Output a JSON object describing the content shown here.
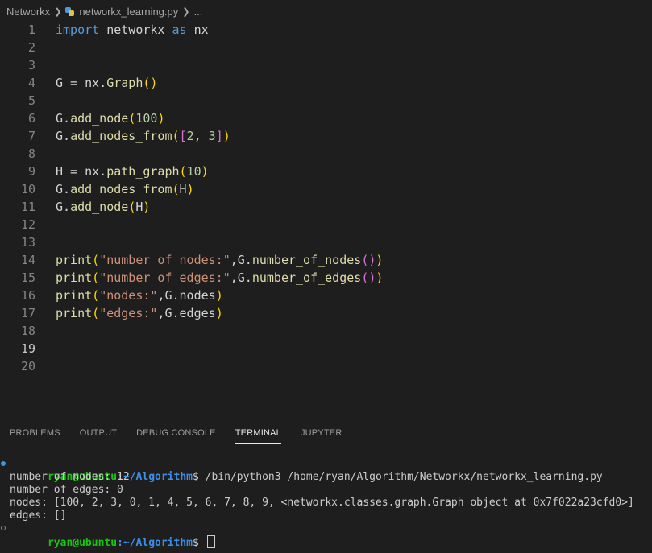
{
  "breadcrumb": {
    "folder": "Networkx",
    "file": "networkx_learning.py",
    "more": "..."
  },
  "editor": {
    "current_line": 19,
    "lines": [
      {
        "n": "1",
        "tokens": [
          {
            "t": "import",
            "c": "kw"
          },
          {
            "t": " networkx "
          },
          {
            "t": "as",
            "c": "kw"
          },
          {
            "t": " nx"
          }
        ]
      },
      {
        "n": "2",
        "tokens": []
      },
      {
        "n": "3",
        "tokens": []
      },
      {
        "n": "4",
        "tokens": [
          {
            "t": "G = nx."
          },
          {
            "t": "Graph",
            "c": "fn"
          },
          {
            "t": "()",
            "c": "br1"
          }
        ]
      },
      {
        "n": "5",
        "tokens": []
      },
      {
        "n": "6",
        "tokens": [
          {
            "t": "G."
          },
          {
            "t": "add_node",
            "c": "fn"
          },
          {
            "t": "(",
            "c": "br1"
          },
          {
            "t": "100",
            "c": "num"
          },
          {
            "t": ")",
            "c": "br1"
          }
        ]
      },
      {
        "n": "7",
        "tokens": [
          {
            "t": "G."
          },
          {
            "t": "add_nodes_from",
            "c": "fn"
          },
          {
            "t": "(",
            "c": "br1"
          },
          {
            "t": "[",
            "c": "br2"
          },
          {
            "t": "2",
            "c": "num"
          },
          {
            "t": ", "
          },
          {
            "t": "3",
            "c": "num"
          },
          {
            "t": "]",
            "c": "br2"
          },
          {
            "t": ")",
            "c": "br1"
          }
        ]
      },
      {
        "n": "8",
        "tokens": []
      },
      {
        "n": "9",
        "tokens": [
          {
            "t": "H = nx."
          },
          {
            "t": "path_graph",
            "c": "fn"
          },
          {
            "t": "(",
            "c": "br1"
          },
          {
            "t": "10",
            "c": "num"
          },
          {
            "t": ")",
            "c": "br1"
          }
        ]
      },
      {
        "n": "10",
        "tokens": [
          {
            "t": "G."
          },
          {
            "t": "add_nodes_from",
            "c": "fn"
          },
          {
            "t": "(",
            "c": "br1"
          },
          {
            "t": "H"
          },
          {
            "t": ")",
            "c": "br1"
          }
        ]
      },
      {
        "n": "11",
        "tokens": [
          {
            "t": "G."
          },
          {
            "t": "add_node",
            "c": "fn"
          },
          {
            "t": "(",
            "c": "br1"
          },
          {
            "t": "H"
          },
          {
            "t": ")",
            "c": "br1"
          }
        ]
      },
      {
        "n": "12",
        "tokens": []
      },
      {
        "n": "13",
        "tokens": []
      },
      {
        "n": "14",
        "tokens": [
          {
            "t": "print",
            "c": "fn"
          },
          {
            "t": "(",
            "c": "br1"
          },
          {
            "t": "\"number of nodes:\"",
            "c": "str"
          },
          {
            "t": ",G."
          },
          {
            "t": "number_of_nodes",
            "c": "fn"
          },
          {
            "t": "()",
            "c": "br2"
          },
          {
            "t": ")",
            "c": "br1"
          }
        ]
      },
      {
        "n": "15",
        "tokens": [
          {
            "t": "print",
            "c": "fn"
          },
          {
            "t": "(",
            "c": "br1"
          },
          {
            "t": "\"number of edges:\"",
            "c": "str"
          },
          {
            "t": ",G."
          },
          {
            "t": "number_of_edges",
            "c": "fn"
          },
          {
            "t": "()",
            "c": "br2"
          },
          {
            "t": ")",
            "c": "br1"
          }
        ]
      },
      {
        "n": "16",
        "tokens": [
          {
            "t": "print",
            "c": "fn"
          },
          {
            "t": "(",
            "c": "br1"
          },
          {
            "t": "\"nodes:\"",
            "c": "str"
          },
          {
            "t": ",G.nodes"
          },
          {
            "t": ")",
            "c": "br1"
          }
        ]
      },
      {
        "n": "17",
        "tokens": [
          {
            "t": "print",
            "c": "fn"
          },
          {
            "t": "(",
            "c": "br1"
          },
          {
            "t": "\"edges:\"",
            "c": "str"
          },
          {
            "t": ",G.edges"
          },
          {
            "t": ")",
            "c": "br1"
          }
        ]
      },
      {
        "n": "18",
        "tokens": []
      },
      {
        "n": "19",
        "tokens": []
      },
      {
        "n": "20",
        "tokens": []
      }
    ]
  },
  "panel": {
    "tabs": [
      {
        "label": "PROBLEMS",
        "name": "tab-problems",
        "active": false
      },
      {
        "label": "OUTPUT",
        "name": "tab-output",
        "active": false
      },
      {
        "label": "DEBUG CONSOLE",
        "name": "tab-debug-console",
        "active": false
      },
      {
        "label": "TERMINAL",
        "name": "tab-terminal",
        "active": true
      },
      {
        "label": "JUPYTER",
        "name": "tab-jupyter",
        "active": false
      }
    ]
  },
  "terminal": {
    "prompt_user": "ryan@ubuntu",
    "prompt_path": ":~/Algorithm",
    "prompt_symbol": "$",
    "command": " /bin/python3 /home/ryan/Algorithm/Networkx/networkx_learning.py",
    "output": [
      "number of nodes: 12",
      "number of edges: 0",
      "nodes: [100, 2, 3, 0, 1, 4, 5, 6, 7, 8, 9, <networkx.classes.graph.Graph object at 0x7f022a23cfd0>]",
      "edges: []"
    ]
  }
}
